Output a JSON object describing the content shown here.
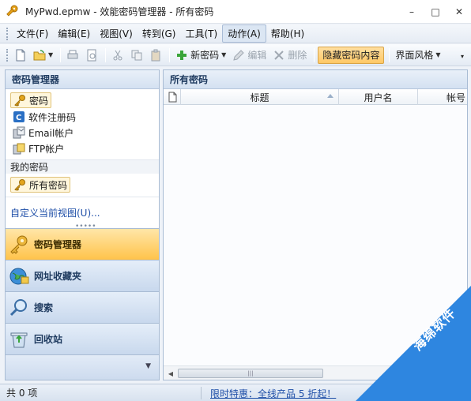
{
  "window": {
    "title": "MyPwd.epmw - 效能密码管理器 - 所有密码",
    "minimize": "–",
    "maximize": "□",
    "close": "✕"
  },
  "menu": [
    "文件(F)",
    "编辑(E)",
    "视图(V)",
    "转到(G)",
    "工具(T)",
    "动作(A)",
    "帮助(H)"
  ],
  "toolbar": {
    "new_password": "新密码",
    "edit": "编辑",
    "delete": "删除",
    "hide_content": "隐藏密码内容",
    "theme": "界面风格"
  },
  "sidebar": {
    "header": "密码管理器",
    "items": [
      {
        "label": "密码",
        "icon": "key-icon"
      },
      {
        "label": "软件注册码",
        "icon": "license-icon"
      },
      {
        "label": "Email帐户",
        "icon": "email-icon"
      },
      {
        "label": "FTP帐户",
        "icon": "ftp-icon"
      }
    ],
    "my_passwords_label": "我的密码",
    "all_passwords": "所有密码",
    "custom_view": "自定义当前视图(U)...",
    "nav_buttons": [
      {
        "label": "密码管理器",
        "icon": "key-icon"
      },
      {
        "label": "网址收藏夹",
        "icon": "globe-icon"
      },
      {
        "label": "搜索",
        "icon": "search-icon"
      },
      {
        "label": "回收站",
        "icon": "recycle-bin-icon"
      }
    ]
  },
  "main": {
    "header": "所有密码",
    "columns": [
      "标题",
      "用户名",
      "帐号"
    ]
  },
  "status": {
    "count": "共 0 项",
    "promo": "限时特惠：全线产品 5 折起！"
  },
  "watermark": {
    "text": "海绵软件"
  }
}
